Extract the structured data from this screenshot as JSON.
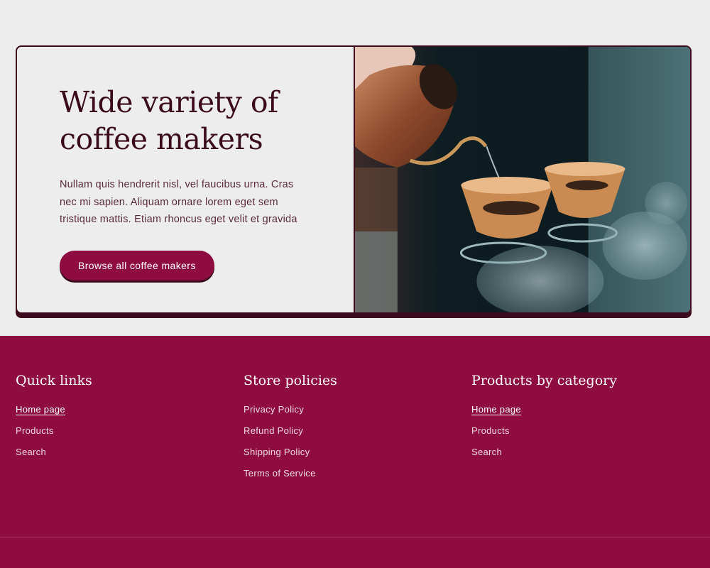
{
  "hero": {
    "title_line1": "Wide variety of",
    "title_line2": "coffee makers",
    "body_line1": "Nullam quis hendrerit nisl, vel faucibus urna. Cras",
    "body_line2": "nec mi sapien. Aliquam ornare lorem eget sem",
    "body_line3": "tristique mattis. Etiam rhoncus eget velit et gravida",
    "button_label": "Browse all coffee makers",
    "image_subject": "pour-over-coffee-photo"
  },
  "colors": {
    "accent": "#8e0c3f",
    "dark": "#3b0a1c",
    "background": "#ededed"
  },
  "footer": {
    "columns": [
      {
        "heading": "Quick links",
        "links": [
          "Home page",
          "Products",
          "Search"
        ]
      },
      {
        "heading": "Store policies",
        "links": [
          "Privacy Policy",
          "Refund Policy",
          "Shipping Policy",
          "Terms of Service"
        ]
      },
      {
        "heading": "Products by category",
        "links": [
          "Home page",
          "Products",
          "Search"
        ]
      }
    ]
  }
}
